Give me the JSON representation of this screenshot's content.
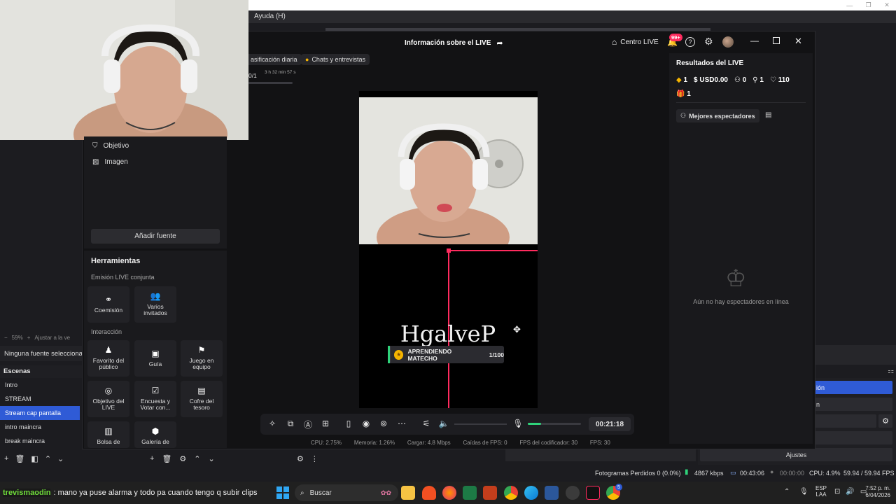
{
  "obs": {
    "menu_help": "Ayuda (H)",
    "zoom_percent": "59%",
    "fit_label": "Ajustar a la ve",
    "no_source": "Ninguna fuente seleccionad",
    "scenes_title": "Escenas",
    "scenes": [
      "Intro",
      "STREAM",
      "Stream cap pantalla",
      "intro maincra",
      "break maincra"
    ],
    "selected_scene": "Stream cap pantalla",
    "right_btn_1": "ión",
    "right_btn_2": "n",
    "ajustes": "Ajustes",
    "status": {
      "dropped": "Fotogramas Perdidos 0 (0.0%)",
      "kbps": "4867 kbps",
      "live_time": "00:43:06",
      "rec_time": "00:00:00",
      "cpu": "CPU: 4.9%",
      "fps": "59.94 / 59.94 FPS"
    }
  },
  "tiktok": {
    "title": "Información sobre el LIVE",
    "centro": "Centro LIVE",
    "notif_badge": "99+",
    "pill_rank": "asificación diaria",
    "pill_chats": "Chats y entrevistas",
    "rank_counter": "0/1",
    "rank_timer": "3 h 32 min 57 s",
    "sources": [
      "Objetivo",
      "Imagen"
    ],
    "add_source": "Añadir fuente",
    "tools": {
      "title": "Herramientas",
      "joint_heading": "Emisión LIVE conjunta",
      "joint_items": [
        "Coemisión",
        "Varios invitados"
      ],
      "interaction_heading": "Interacción",
      "interaction_items": [
        "Favorito del público",
        "Guía",
        "Juego en equipo",
        "Objetivo del LIVE",
        "Encuesta y Votar con...",
        "Cofre del tesoro",
        "Bolsa de",
        "Galería de"
      ]
    },
    "overlay_name": "HgalveP",
    "goal_label": "APRENDIENDO MATECHO",
    "goal_progress": "1/100",
    "goal_fraction": 0.01,
    "timer": "00:21:18",
    "volume_level": 0.25,
    "stats": {
      "cpu": "CPU: 2.75%",
      "mem": "Memoria: 1.26%",
      "upload": "Cargar: 4.8 Mbps",
      "fps_drops": "Caídas de FPS: 0",
      "encoder_fps": "FPS del codificador: 30",
      "fps": "FPS: 30"
    },
    "results": {
      "title": "Resultados del LIVE",
      "diamonds": "1",
      "usd": "USD0.00",
      "viewers": "0",
      "followers": "1",
      "likes": "110",
      "gifts": "1",
      "top_viewers": "Mejores espectadores",
      "empty": "Aún no hay espectadores en línea"
    }
  },
  "taskbar": {
    "chat_user": "trevismaodin",
    "chat_msg": ": mano ya puse alarma y todo pa cuando tengo q subir clips",
    "search_placeholder": "Buscar",
    "lang": "ESP",
    "lang2": "LAA",
    "time": "7:52 p. m.",
    "date": "6/04/2026",
    "copilot_badge": "5"
  },
  "colors": {
    "accent_blue": "#2f5bd6",
    "tiktok_red": "#ff2b5e",
    "live_green": "#2fd27a",
    "chat_green": "#6fdc3a"
  }
}
